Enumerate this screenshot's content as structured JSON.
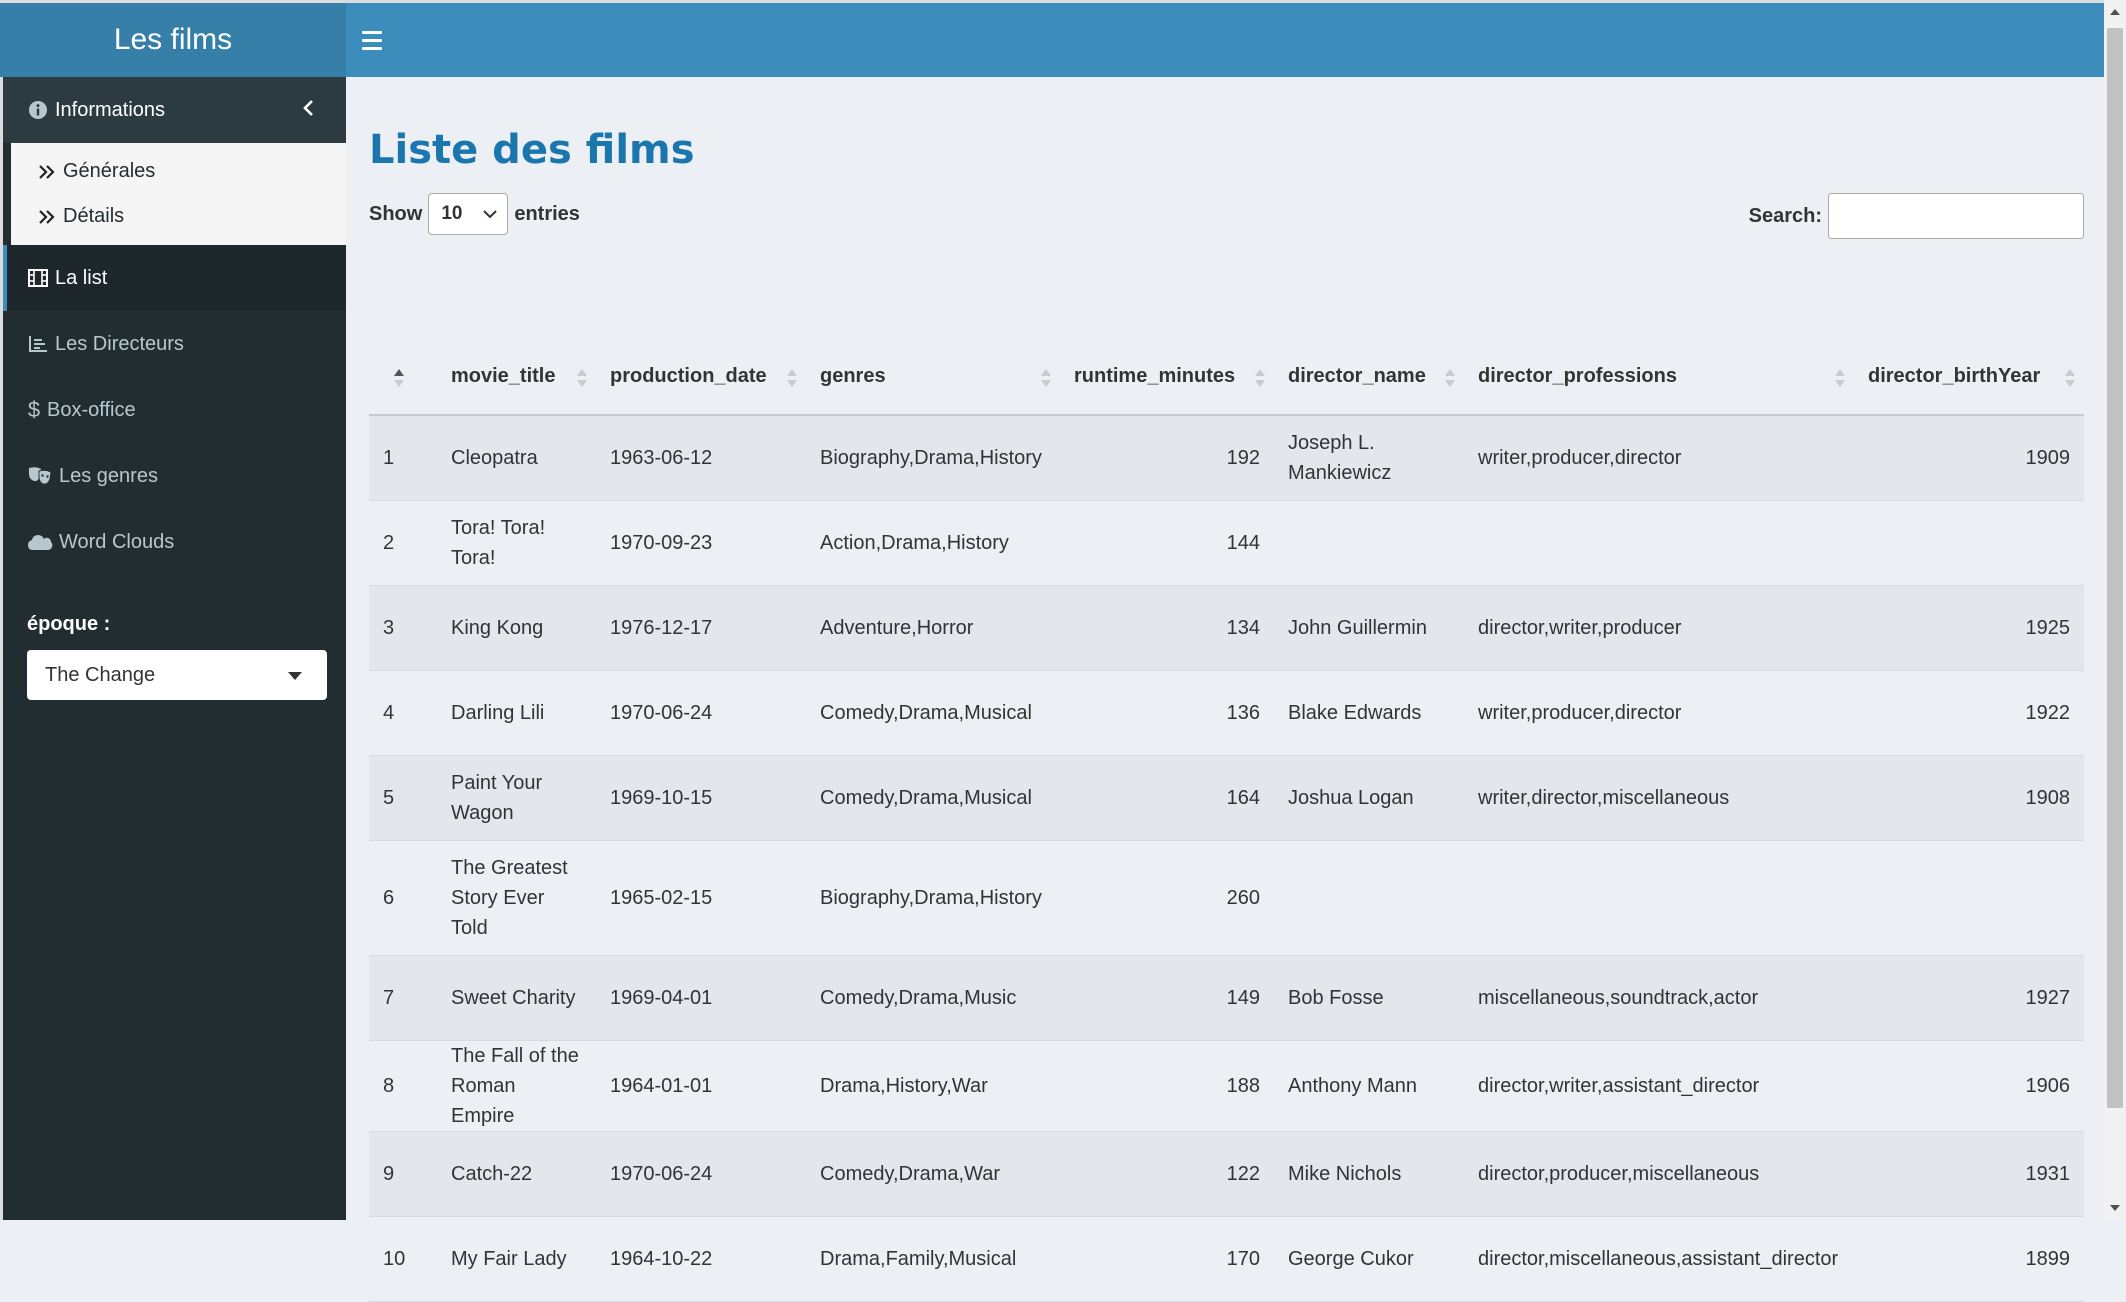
{
  "header": {
    "logo": "Les films"
  },
  "sidebar": {
    "info": {
      "label": "Informations"
    },
    "sub": [
      {
        "label": "Générales"
      },
      {
        "label": "Détails"
      }
    ],
    "items": [
      {
        "label": "La list",
        "icon": "film-icon"
      },
      {
        "label": "Les Directeurs",
        "icon": "list-icon"
      },
      {
        "label": "Box-office",
        "icon": "dollar-icon"
      },
      {
        "label": "Les genres",
        "icon": "theater-masks-icon"
      },
      {
        "label": "Word Clouds",
        "icon": "cloud-icon"
      }
    ],
    "epoque": {
      "label": "époque :",
      "value": "The Change"
    }
  },
  "main": {
    "title": "Liste des films",
    "show_label": "Show",
    "length_value": "10",
    "entries_label": "entries",
    "search_label": "Search:",
    "search_value": ""
  },
  "table": {
    "columns": [
      "",
      "movie_title",
      "production_date",
      "genres",
      "runtime_minutes",
      "director_name",
      "director_professions",
      "director_birthYear"
    ],
    "rows": [
      [
        "1",
        "Cleopatra",
        "1963-06-12",
        "Biography,Drama,History",
        "192",
        "Joseph L. Mankiewicz",
        "writer,producer,director",
        "1909"
      ],
      [
        "2",
        "Tora! Tora! Tora!",
        "1970-09-23",
        "Action,Drama,History",
        "144",
        "",
        "",
        ""
      ],
      [
        "3",
        "King Kong",
        "1976-12-17",
        "Adventure,Horror",
        "134",
        "John Guillermin",
        "director,writer,producer",
        "1925"
      ],
      [
        "4",
        "Darling Lili",
        "1970-06-24",
        "Comedy,Drama,Musical",
        "136",
        "Blake Edwards",
        "writer,producer,director",
        "1922"
      ],
      [
        "5",
        "Paint Your Wagon",
        "1969-10-15",
        "Comedy,Drama,Musical",
        "164",
        "Joshua Logan",
        "writer,director,miscellaneous",
        "1908"
      ],
      [
        "6",
        "The Greatest Story Ever Told",
        "1965-02-15",
        "Biography,Drama,History",
        "260",
        "",
        "",
        ""
      ],
      [
        "7",
        "Sweet Charity",
        "1969-04-01",
        "Comedy,Drama,Music",
        "149",
        "Bob Fosse",
        "miscellaneous,soundtrack,actor",
        "1927"
      ],
      [
        "8",
        "The Fall of the Roman Empire",
        "1964-01-01",
        "Drama,History,War",
        "188",
        "Anthony Mann",
        "director,writer,assistant_director",
        "1906"
      ],
      [
        "9",
        "Catch-22",
        "1970-06-24",
        "Comedy,Drama,War",
        "122",
        "Mike Nichols",
        "director,producer,miscellaneous",
        "1931"
      ],
      [
        "10",
        "My Fair Lady",
        "1964-10-22",
        "Drama,Family,Musical",
        "170",
        "George Cukor",
        "director,miscellaneous,assistant_director",
        "1899"
      ]
    ]
  },
  "colors": {
    "header": "#3c8dbc",
    "logo_bg": "#367fa9",
    "sidebar": "#222d32",
    "title": "#1a76ad"
  }
}
